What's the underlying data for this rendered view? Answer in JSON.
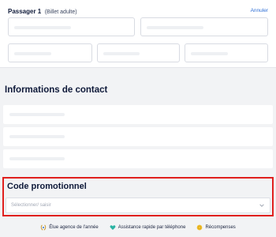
{
  "passenger": {
    "title": "Passager 1",
    "subtitle": "(Billet adulte)",
    "cancel_label": "Annuler"
  },
  "contact": {
    "title": "Informations de contact"
  },
  "promo": {
    "title": "Code promotionnel",
    "placeholder": "Sélectionner/ saisir"
  },
  "footer": {
    "badges": [
      {
        "label": "Élue agence de l'année",
        "icon": "laurel-icon"
      },
      {
        "label": "Assistance rapide par téléphone",
        "icon": "heart-icon"
      },
      {
        "label": "Récompenses",
        "icon": "coin-icon"
      }
    ]
  },
  "colors": {
    "accent_blue": "#2f6fd6",
    "highlight_red": "#e0201e",
    "title_navy": "#0f1a3a"
  }
}
